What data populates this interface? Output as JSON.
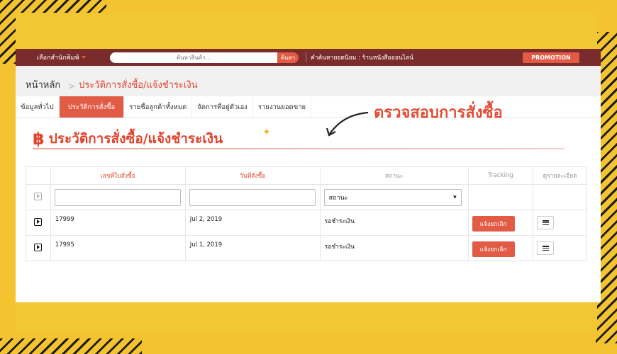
{
  "topbar": {
    "store_select_label": "เลือกสำนักพิมพ์",
    "search_placeholder": "ค้นหาสินค้า...",
    "search_button": "ค้นหา",
    "popular_label": "คำค้นหายอดนิยม : ร้านหนังสือออนไลน์",
    "promotion_button": "PROMOTION"
  },
  "breadcrumb": {
    "home": "หน้าหลัก",
    "separator": ">",
    "current": "ประวัติการสั่งซื้อ/แจ้งชำระเงิน"
  },
  "tabs": [
    {
      "label": "ข้อมูลทั่วไป",
      "active": false
    },
    {
      "label": "ประวัติการสั่งซื้อ",
      "active": true
    },
    {
      "label": "รายชื่อลูกค้าทั้งหมด",
      "active": false
    },
    {
      "label": "จัดการที่อยู่ตัวเอง",
      "active": false
    },
    {
      "label": "รายงานยอดขาย",
      "active": false
    }
  ],
  "heading": {
    "icon": "baht-icon",
    "title": "ประวัติการสั่งซื้อ/แจ้งชำระเงิน"
  },
  "annotation": {
    "text": "ตรวจสอบการสั่งซื้อ"
  },
  "table": {
    "headers": [
      "เลขที่ใบสั่งซื้อ",
      "วันที่สั่งซื้อ",
      "สถานะ",
      "Tracking",
      "ดูรายละเอียด"
    ],
    "status_filter": "สถานะ",
    "rows": [
      {
        "order_no": "17999",
        "date": "Jul 2, 2019",
        "status": "รอชำระเงิน",
        "action": "แจ้งยกเลิก"
      },
      {
        "order_no": "17995",
        "date": "Jul 1, 2019",
        "status": "รอชำระเงิน",
        "action": "แจ้งยกเลิก"
      }
    ]
  },
  "colors": {
    "topbar": "#7a2b2b",
    "accent": "#e25b45",
    "background": "#f4c430"
  }
}
